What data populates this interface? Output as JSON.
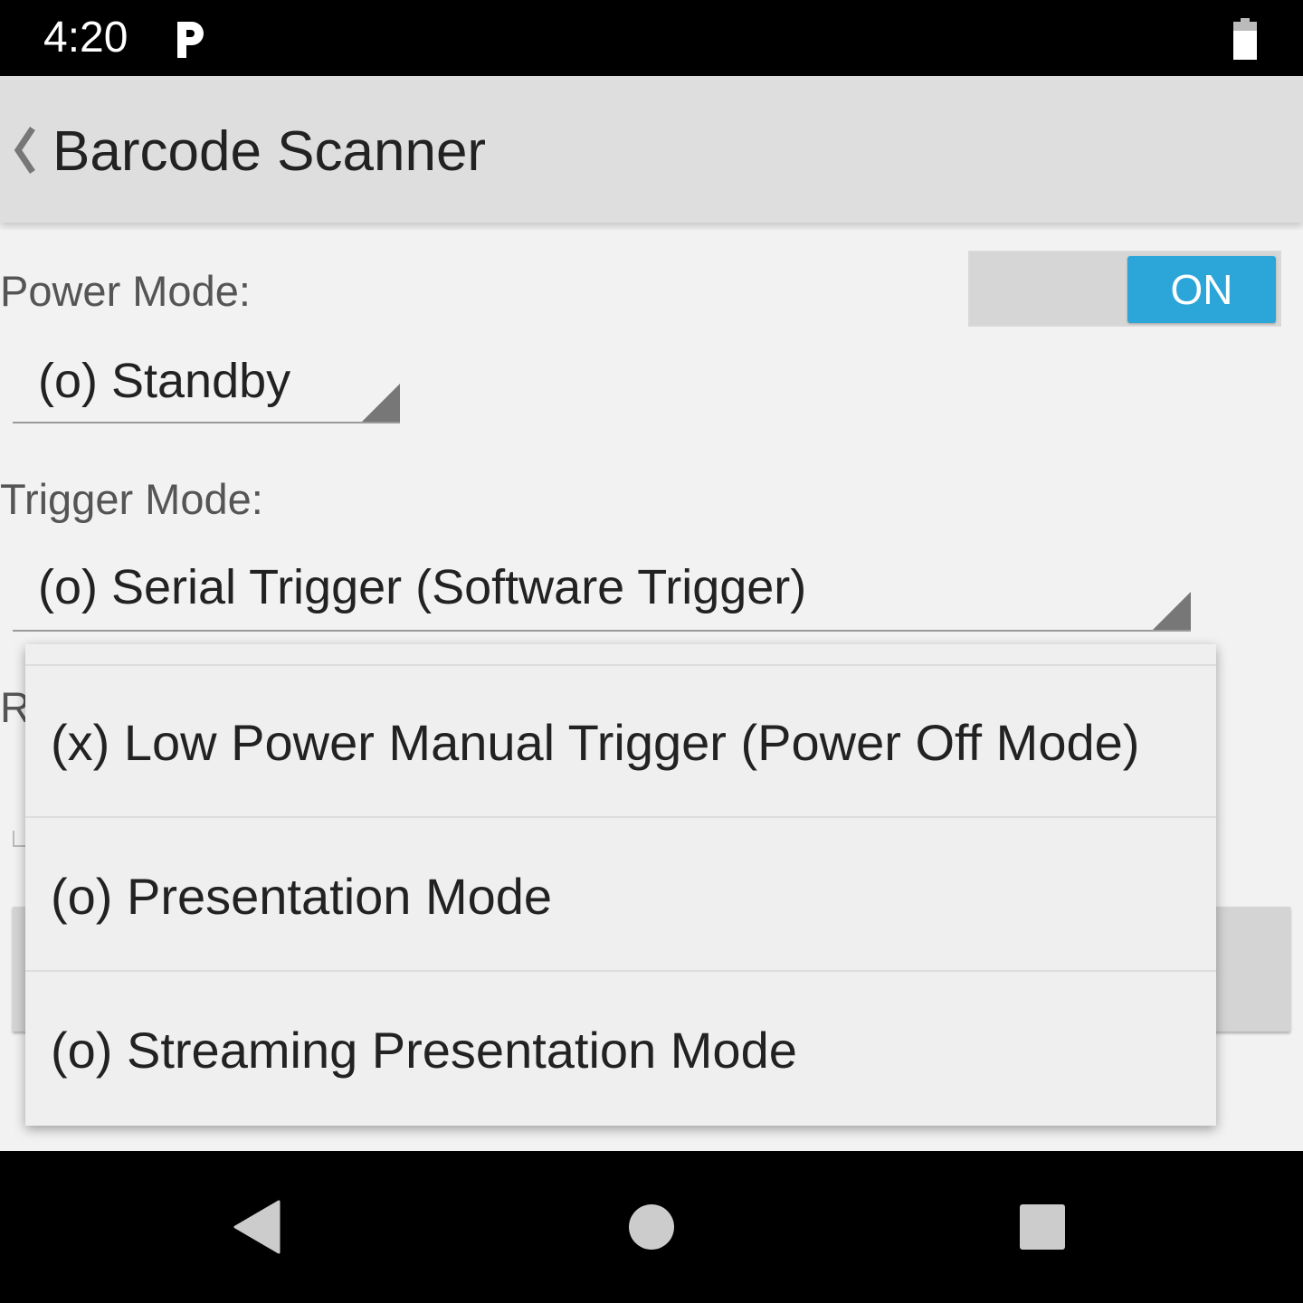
{
  "status_bar": {
    "time": "4:20",
    "icons": [
      "parking-icon",
      "battery-icon"
    ]
  },
  "app_bar": {
    "title": "Barcode Scanner",
    "back_icon": "back-chevron-icon"
  },
  "power_mode": {
    "label": "Power Mode:",
    "selected": "(o) Standby",
    "toggle_state": "ON",
    "toggle_color": "#2ca5d8"
  },
  "trigger_mode": {
    "label": "Trigger Mode:",
    "selected": "(o) Serial Trigger (Software Trigger)"
  },
  "partially_hidden_label": "R",
  "dropdown": {
    "options": [
      "(x) Low Power Manual Trigger (Power Off Mode)",
      "(o) Presentation Mode",
      "(o) Streaming Presentation Mode"
    ]
  },
  "nav_bar": {
    "icons": [
      "nav-back-icon",
      "nav-home-icon",
      "nav-recents-icon"
    ]
  }
}
